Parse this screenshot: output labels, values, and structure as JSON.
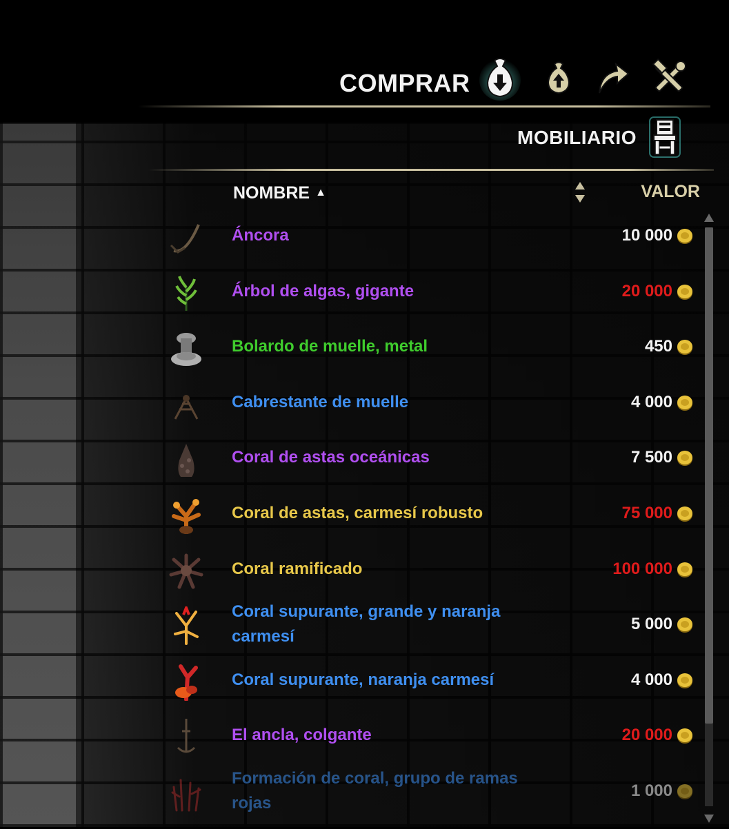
{
  "header": {
    "title": "COMPRAR",
    "tabs": [
      {
        "icon": "buy-bag-icon",
        "active": true
      },
      {
        "icon": "sell-bag-icon",
        "active": false
      },
      {
        "icon": "buyback-arrow-icon",
        "active": false
      },
      {
        "icon": "repair-tools-icon",
        "active": false
      }
    ]
  },
  "category": {
    "title": "MOBILIARIO",
    "icon": "chair-icon"
  },
  "columns": {
    "name": "NOMBRE",
    "name_sort": "▲",
    "value": "VALOR"
  },
  "colors": {
    "purple": "#b04ff0",
    "green": "#3fcc2d",
    "blue": "#3f8ff0",
    "gold": "#e8c84a",
    "white": "#f2f2f2",
    "red": "#e01b1b"
  },
  "items": [
    {
      "name": "Áncora",
      "price": "10 000",
      "name_color": "purple",
      "price_color": "white",
      "icon": "anchor-icon"
    },
    {
      "name": "Árbol de algas, gigante",
      "price": "20 000",
      "name_color": "purple",
      "price_color": "red",
      "icon": "kelp-tree-icon"
    },
    {
      "name": "Bolardo de muelle, metal",
      "price": "450",
      "name_color": "green",
      "price_color": "white",
      "icon": "bollard-icon"
    },
    {
      "name": "Cabrestante de muelle",
      "price": "4 000",
      "name_color": "blue",
      "price_color": "white",
      "icon": "capstan-icon"
    },
    {
      "name": "Coral de astas oceánicas",
      "price": "7 500",
      "name_color": "purple",
      "price_color": "white",
      "icon": "antler-coral-icon"
    },
    {
      "name": "Coral de astas, carmesí robusto",
      "price": "75 000",
      "name_color": "gold",
      "price_color": "red",
      "icon": "crimson-coral-icon"
    },
    {
      "name": "Coral ramificado",
      "price": "100 000",
      "name_color": "gold",
      "price_color": "red",
      "icon": "branching-coral-icon"
    },
    {
      "name": "Coral supurante, grande y naranja carmesí",
      "price": "5 000",
      "name_color": "blue",
      "price_color": "white",
      "icon": "orange-coral-large-icon"
    },
    {
      "name": "Coral supurante, naranja carmesí",
      "price": "4 000",
      "name_color": "blue",
      "price_color": "white",
      "icon": "orange-coral-icon"
    },
    {
      "name": "El ancla, colgante",
      "price": "20 000",
      "name_color": "purple",
      "price_color": "red",
      "icon": "hanging-anchor-icon"
    },
    {
      "name": "Formación de coral, grupo de ramas rojas",
      "price": "1 000",
      "name_color": "blue",
      "price_color": "white",
      "icon": "red-coral-formation-icon"
    }
  ]
}
